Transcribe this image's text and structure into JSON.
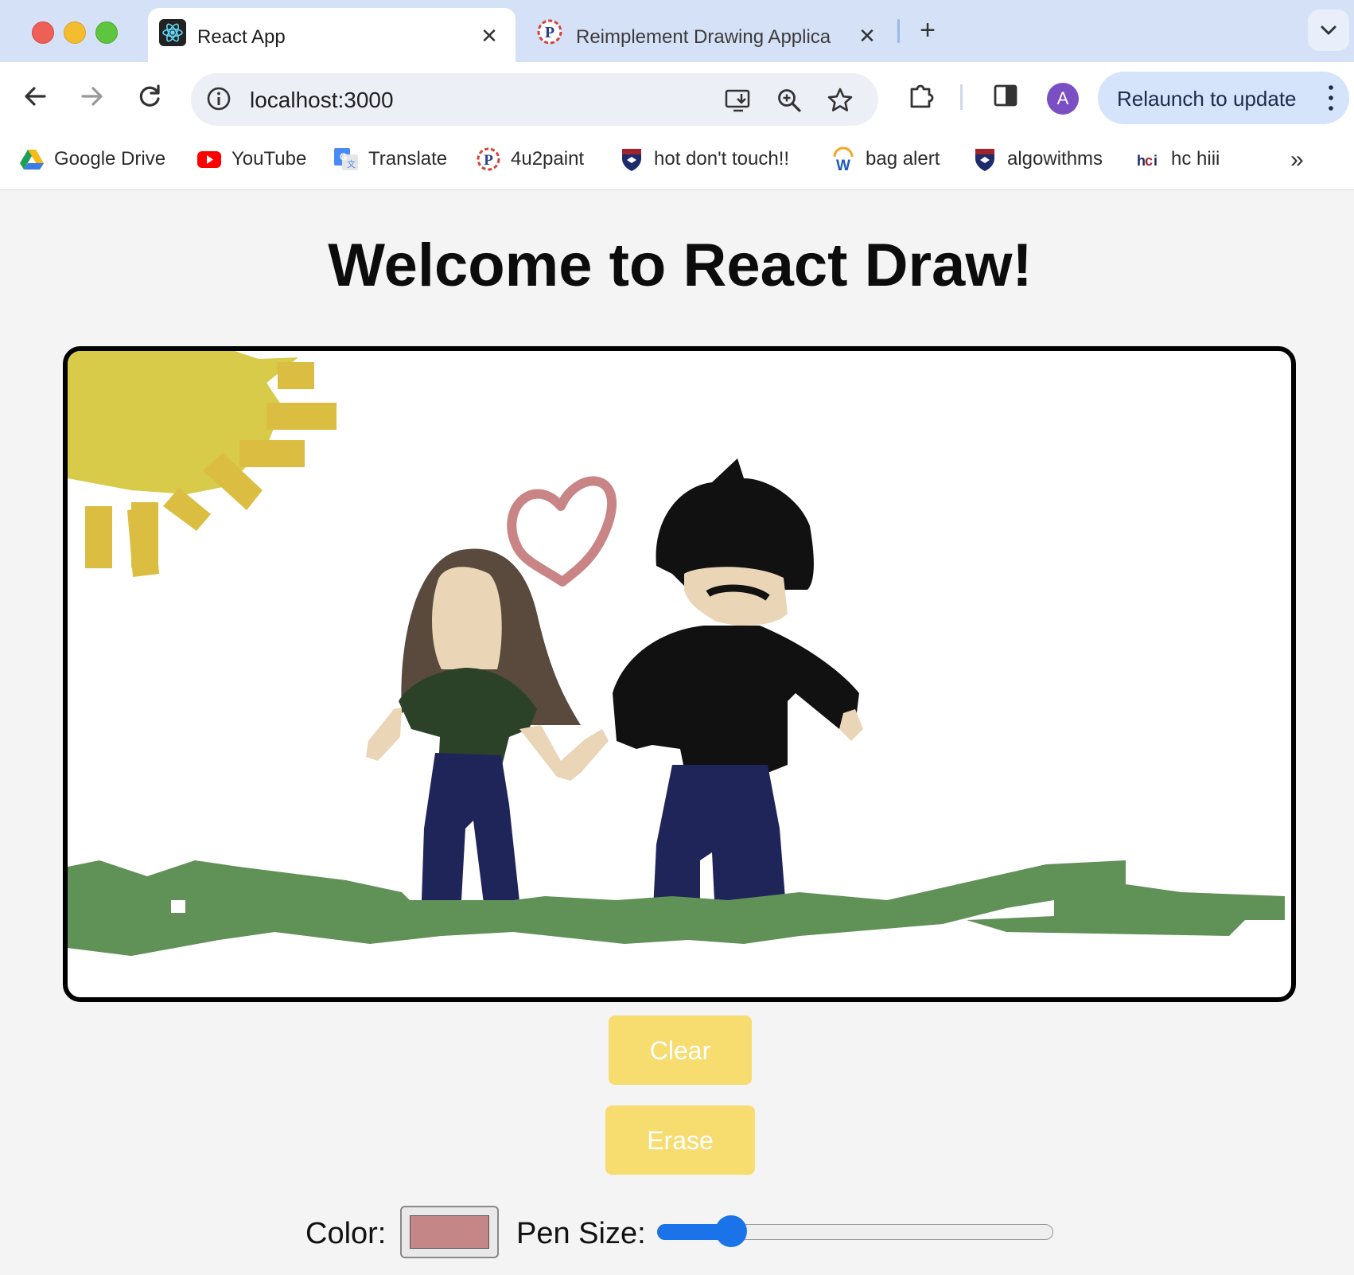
{
  "browser": {
    "tabs": [
      {
        "title": "React App",
        "active": true
      },
      {
        "title": "Reimplement Drawing Applica",
        "active": false
      }
    ],
    "address": "localhost:3000",
    "profile_initial": "A",
    "relaunch_label": "Relaunch to update",
    "bookmarks": [
      {
        "label": "Google Drive",
        "icon": "google-drive-icon"
      },
      {
        "label": "YouTube",
        "icon": "youtube-icon"
      },
      {
        "label": "Translate",
        "icon": "translate-icon"
      },
      {
        "label": "4u2paint",
        "icon": "4u2paint-icon"
      },
      {
        "label": "hot don't touch!!",
        "icon": "penn-shield-icon"
      },
      {
        "label": "bag alert",
        "icon": "workday-icon"
      },
      {
        "label": "algowithms",
        "icon": "penn-shield-icon"
      },
      {
        "label": "hc hiii",
        "icon": "hci-icon"
      }
    ]
  },
  "app": {
    "title": "Welcome to React Draw!",
    "clear_label": "Clear",
    "erase_label": "Erase",
    "color_label": "Color:",
    "pen_size_label": "Pen Size:",
    "selected_color": "#c48686",
    "pen_size_fraction": 0.16,
    "colors": {
      "button_bg": "#f7dc6f",
      "sun": "#d8cb4a",
      "sun_rays": "#dbbd41",
      "heart": "#c98585",
      "hair_woman": "#5a4a3e",
      "skin": "#ead5b6",
      "shirt_woman": "#2b4229",
      "pants": "#1f2459",
      "man_black": "#111111",
      "grass": "#609157"
    }
  }
}
